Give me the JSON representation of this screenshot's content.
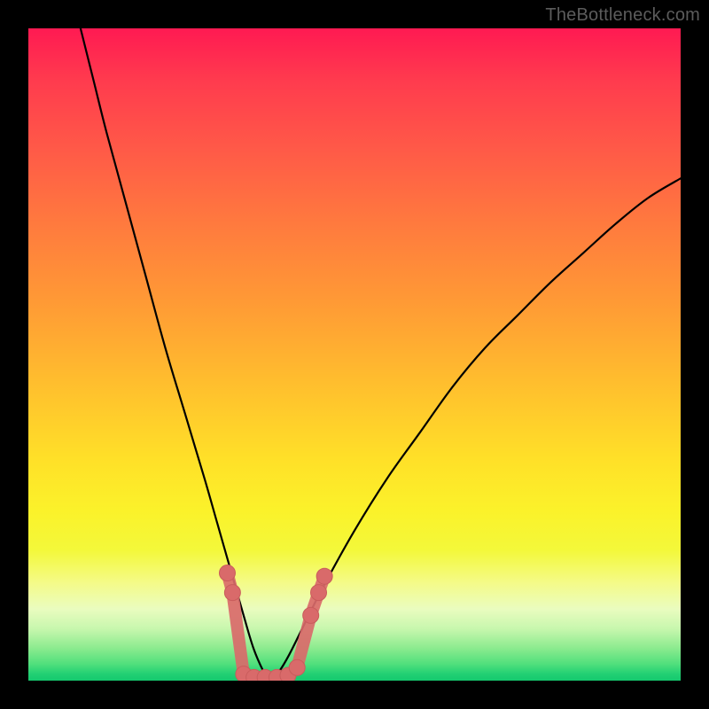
{
  "watermark": "TheBottleneck.com",
  "colors": {
    "curve_stroke": "#000000",
    "marker_fill": "#d96a6a",
    "marker_stroke": "#c95c5c",
    "bg_black": "#000000"
  },
  "chart_data": {
    "type": "line",
    "title": "",
    "xlabel": "",
    "ylabel": "",
    "xlim": [
      0,
      100
    ],
    "ylim": [
      0,
      100
    ],
    "grid": false,
    "legend": false,
    "notes": "No axis ticks or labels are shown in the image; x/y values are estimated from pixel positions normalized to 0–100. The curve resembles a bottleneck V-curve dipping to ~0 near x≈37, with scattered marker points near the trough.",
    "series": [
      {
        "name": "curve",
        "style": "line",
        "x": [
          8,
          10,
          12,
          15,
          18,
          21,
          24,
          27,
          29,
          31,
          33,
          34.5,
          36,
          37,
          38.5,
          40,
          42,
          45,
          50,
          55,
          60,
          65,
          70,
          75,
          80,
          85,
          90,
          95,
          100
        ],
        "y": [
          100,
          92,
          84,
          73,
          62,
          51,
          41,
          31,
          24,
          17,
          10,
          5,
          1.5,
          0,
          1.5,
          4,
          8,
          14,
          23,
          31,
          38,
          45,
          51,
          56,
          61,
          65.5,
          70,
          74,
          77
        ]
      },
      {
        "name": "markers",
        "style": "scatter",
        "x": [
          30.5,
          31.3,
          33.0,
          34.6,
          36.3,
          38.1,
          39.8,
          41.2,
          43.3,
          44.5,
          45.4
        ],
        "y": [
          16.5,
          13.5,
          1.0,
          0.5,
          0.5,
          0.5,
          0.8,
          2.0,
          10.0,
          13.5,
          16.0
        ]
      }
    ]
  }
}
